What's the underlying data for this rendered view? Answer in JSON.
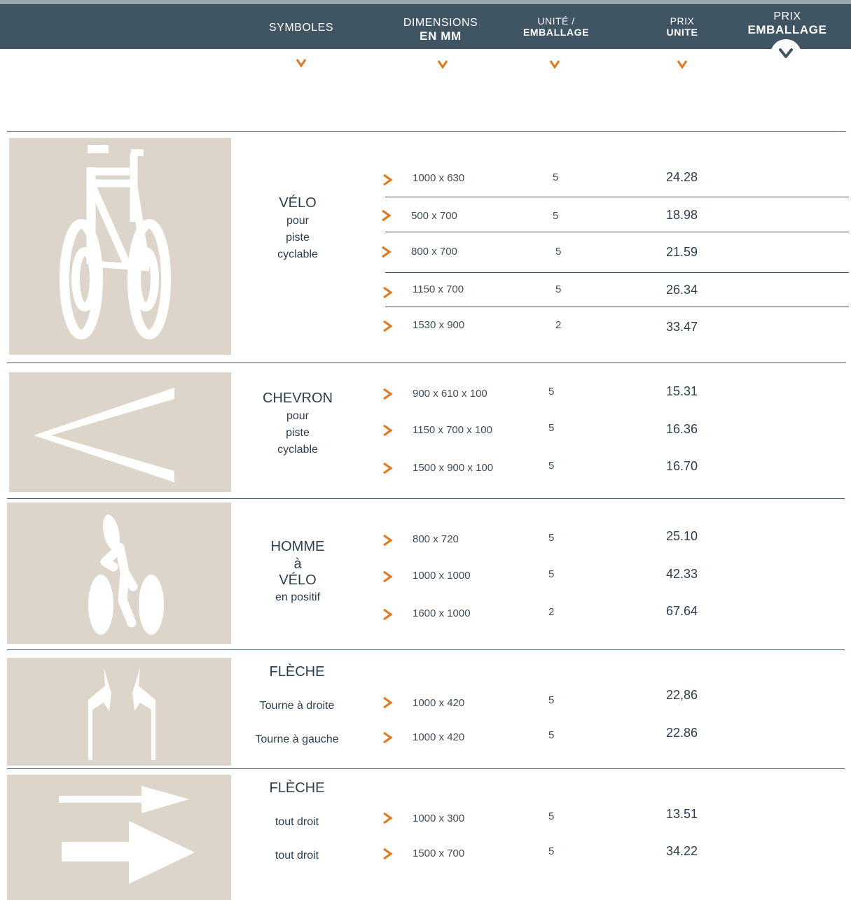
{
  "header": {
    "symboles": "SYMBOLES",
    "dimensions_l1": "DIMENSIONS",
    "dimensions_l2": "EN MM",
    "unite_l1": "UNITÉ /",
    "unite_l2": "EMBALLAGE",
    "prix_unite_l1": "PRIX",
    "prix_unite_l2": "UNITE",
    "prix_emb_l1": "PRIX",
    "prix_emb_l2": "EMBALLAGE"
  },
  "colors": {
    "header": "#3f5564",
    "accent": "#e07a1f",
    "symbol_bg": "#ddd5ca"
  },
  "products": [
    {
      "title": "VÉLO",
      "subtitle": [
        "pour",
        "piste",
        "cyclable"
      ],
      "icon": "bicycle-icon",
      "rows": [
        {
          "dim": "1000 x 630",
          "qty": "5",
          "price": "24.28"
        },
        {
          "dim": "500 x 700",
          "qty": "5",
          "price": "18.98"
        },
        {
          "dim": "800 x 700",
          "qty": "5",
          "price": "21.59"
        },
        {
          "dim": "1150 x 700",
          "qty": "5",
          "price": "26.34"
        },
        {
          "dim": "1530 x 900",
          "qty": "2",
          "price": "33.47"
        }
      ]
    },
    {
      "title": "CHEVRON",
      "subtitle": [
        "pour",
        "piste",
        "cyclable"
      ],
      "icon": "chevron-icon",
      "rows": [
        {
          "dim": "900 x 610 x 100",
          "qty": "5",
          "price": "15.31"
        },
        {
          "dim": "1150 x 700 x 100",
          "qty": "5",
          "price": "16.36"
        },
        {
          "dim": "1500 x 900 x 100",
          "qty": "5",
          "price": "16.70"
        }
      ]
    },
    {
      "title": "HOMME",
      "title2": "à",
      "title3": "VÉLO",
      "subtitle": [
        "en positif"
      ],
      "icon": "cyclist-icon",
      "rows": [
        {
          "dim": "800 x 720",
          "qty": "5",
          "price": "25.10"
        },
        {
          "dim": "1000 x 1000",
          "qty": "5",
          "price": "42.33"
        },
        {
          "dim": "1600 x 1000",
          "qty": "2",
          "price": "67.64"
        }
      ]
    },
    {
      "title": "FLÈCHE",
      "icon": "turn-arrows-icon",
      "rows": [
        {
          "label": "Tourne à droite",
          "dim": "1000 x 420",
          "qty": "5",
          "price": "22,86"
        },
        {
          "label": "Tourne à gauche",
          "dim": "1000 x 420",
          "qty": "5",
          "price": "22.86"
        }
      ]
    },
    {
      "title": "FLÈCHE",
      "icon": "straight-arrows-icon",
      "rows": [
        {
          "label": "tout droit",
          "dim": "1000 x 300",
          "qty": "5",
          "price": "13.51"
        },
        {
          "label": "tout droit",
          "dim": "1500 x 700",
          "qty": "5",
          "price": "34.22"
        }
      ]
    }
  ]
}
